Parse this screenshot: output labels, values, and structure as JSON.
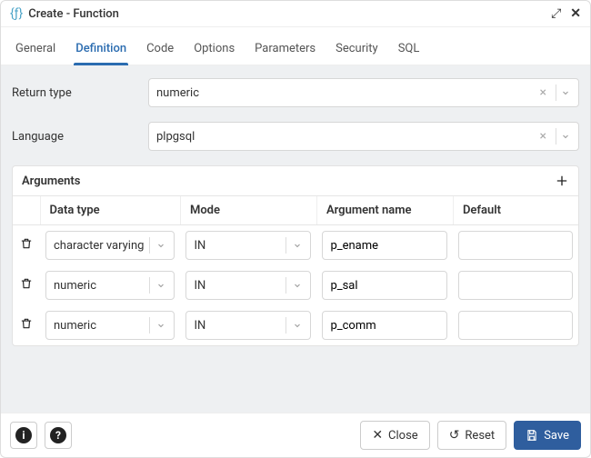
{
  "title": "Create - Function",
  "tabs": [
    "General",
    "Definition",
    "Code",
    "Options",
    "Parameters",
    "Security",
    "SQL"
  ],
  "active_tab": "Definition",
  "form": {
    "return_type": {
      "label": "Return type",
      "value": "numeric"
    },
    "language": {
      "label": "Language",
      "value": "plpgsql"
    }
  },
  "arguments": {
    "title": "Arguments",
    "columns": [
      "Data type",
      "Mode",
      "Argument name",
      "Default"
    ],
    "rows": [
      {
        "data_type": "character varying",
        "mode": "IN",
        "name": "p_ename",
        "default": ""
      },
      {
        "data_type": "numeric",
        "mode": "IN",
        "name": "p_sal",
        "default": ""
      },
      {
        "data_type": "numeric",
        "mode": "IN",
        "name": "p_comm",
        "default": ""
      }
    ]
  },
  "footer": {
    "close": "Close",
    "reset": "Reset",
    "save": "Save"
  }
}
